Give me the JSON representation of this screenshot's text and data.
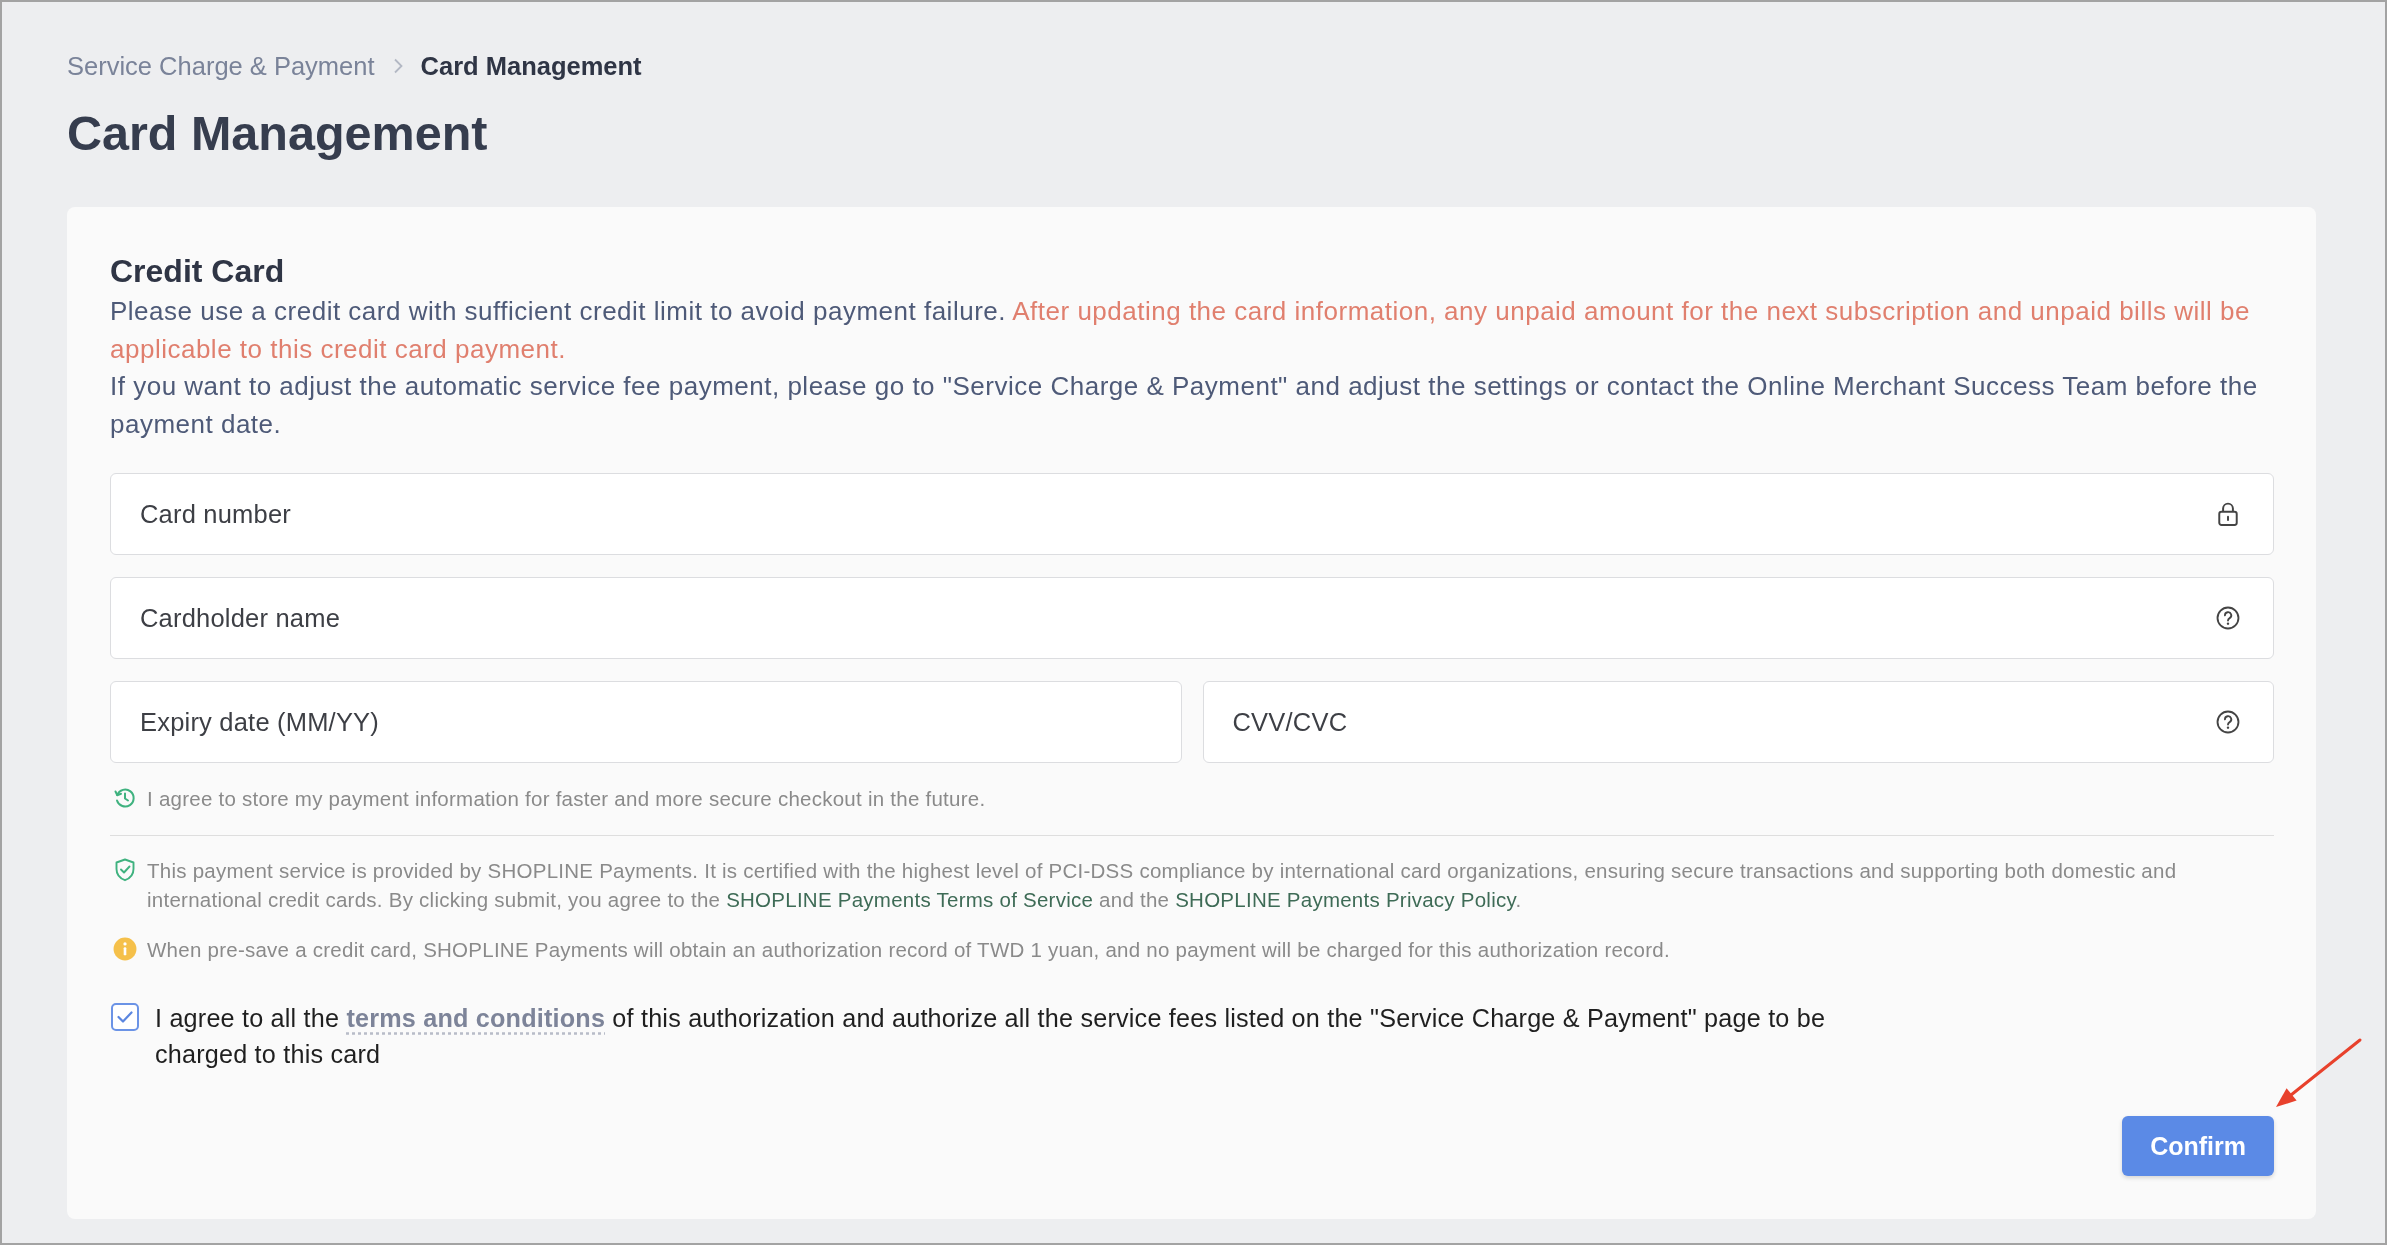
{
  "breadcrumb": [
    {
      "label": "Service Charge & Payment",
      "current": false
    },
    {
      "label": "Card Management",
      "current": true
    }
  ],
  "page_title": "Card Management",
  "card": {
    "title": "Credit Card",
    "notice": {
      "text": "Please use a credit card with sufficient credit limit to avoid payment failure.",
      "warning": "After updating the card information, any unpaid amount for the next subscription and unpaid bills will be applicable to this credit card payment."
    },
    "note": "If you want to adjust the automatic service fee payment, please go to \"Service Charge & Payment\" and adjust the settings or contact the Online Merchant Success Team before the payment date.",
    "field_rows": [
      [
        {
          "kind": "secure",
          "placeholder": "Card number"
        }
      ],
      [
        {
          "kind": "help",
          "placeholder": "Cardholder name"
        }
      ],
      [
        {
          "kind": "plain",
          "placeholder": "Expiry date (MM/YY)"
        },
        {
          "kind": "help",
          "placeholder": "CVV/CVC"
        }
      ]
    ],
    "store_consent": "I agree to store my payment information for faster and more secure checkout in the future.",
    "security_note": [
      {
        "kind": "text",
        "text": "This payment service is provided by SHOPLINE Payments. It is certified with the highest level of PCI-DSS compliance by international card organizations, ensuring secure transactions and supporting both domestic and international credit cards. By clicking submit, you agree to the "
      },
      {
        "kind": "link",
        "text": "SHOPLINE Payments Terms of Service"
      },
      {
        "kind": "text",
        "text": " and the "
      },
      {
        "kind": "link",
        "text": "SHOPLINE Payments Privacy Policy"
      },
      {
        "kind": "text",
        "text": "."
      }
    ],
    "authorization_note": "When pre-save a credit card, SHOPLINE Payments will obtain an authorization record of TWD 1 yuan, and no payment will be charged for this authorization record.",
    "agreement": {
      "checked": true,
      "parts": [
        {
          "kind": "text",
          "text": "I agree to all the "
        },
        {
          "kind": "link",
          "text": "terms and conditions"
        },
        {
          "kind": "text",
          "text": " of this authorization and authorize all the service fees listed on the \"Service Charge & Payment\" page to be charged to this card"
        }
      ]
    },
    "confirm_button": "Confirm"
  }
}
